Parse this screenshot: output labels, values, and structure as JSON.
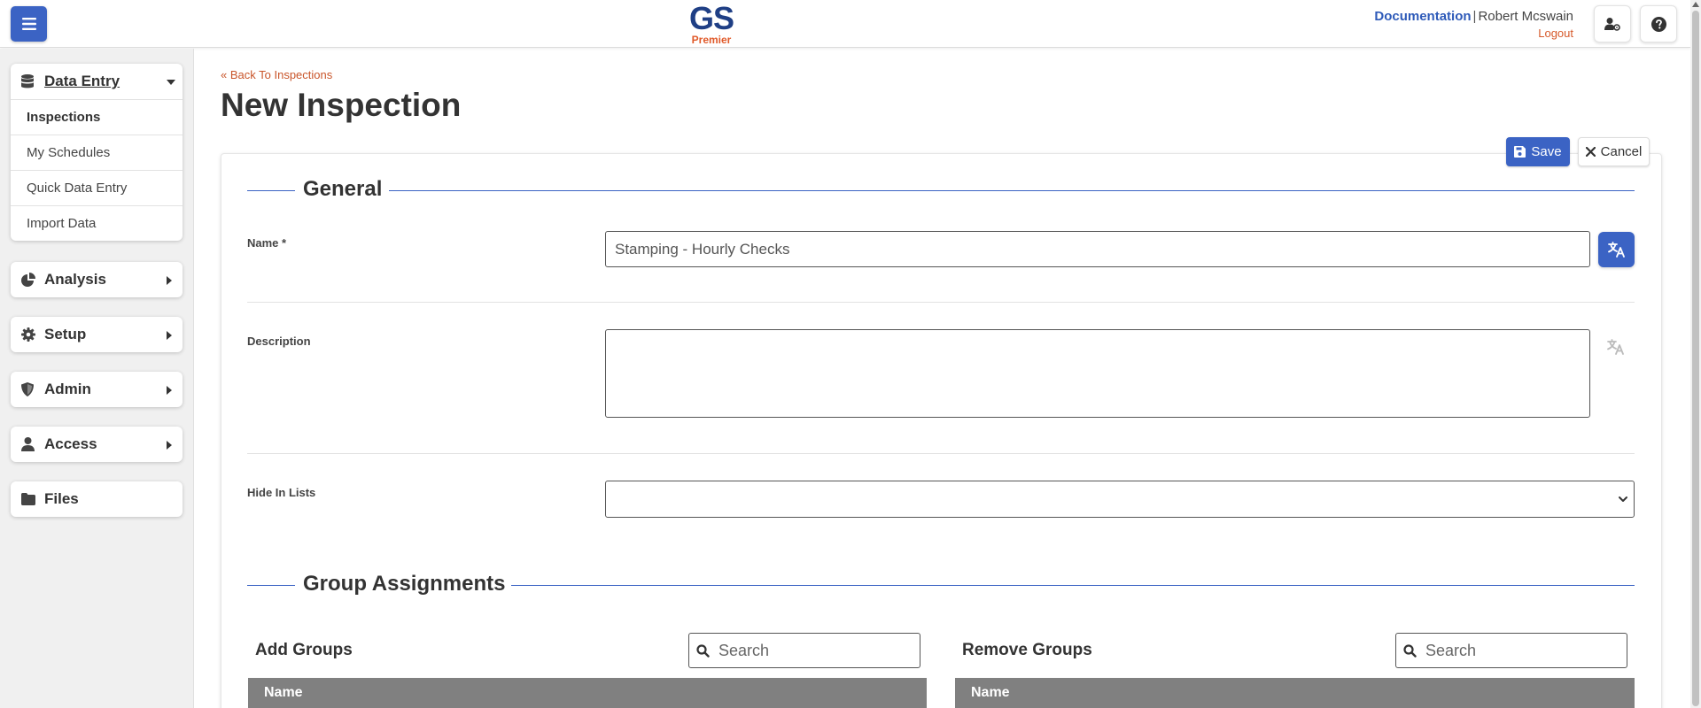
{
  "header": {
    "logo_main": "GS",
    "logo_sub": "Premier",
    "documentation_link": "Documentation",
    "separator": "|",
    "user_name": "Robert Mcswain",
    "logout_link": "Logout"
  },
  "sidebar": {
    "data_entry": {
      "label": "Data Entry",
      "items": [
        "Inspections",
        "My Schedules",
        "Quick Data Entry",
        "Import Data"
      ]
    },
    "sections": [
      {
        "label": "Analysis"
      },
      {
        "label": "Setup"
      },
      {
        "label": "Admin"
      },
      {
        "label": "Access"
      },
      {
        "label": "Files"
      }
    ]
  },
  "main": {
    "back_link": "Back To Inspections",
    "title": "New Inspection",
    "save_label": "Save",
    "cancel_label": "Cancel",
    "general_section": "General",
    "name_label": "Name *",
    "name_value": "Stamping - Hourly Checks",
    "description_label": "Description",
    "description_value": "",
    "hide_in_lists_label": "Hide In Lists",
    "hide_in_lists_value": "",
    "group_section": "Group Assignments",
    "add_groups_label": "Add Groups",
    "remove_groups_label": "Remove Groups",
    "search_placeholder": "Search",
    "table_header_name": "Name"
  },
  "colors": {
    "primary": "#3b63c4",
    "accent": "#d65a2b",
    "logo_blue": "#1f3f85",
    "table_header": "#808080"
  }
}
